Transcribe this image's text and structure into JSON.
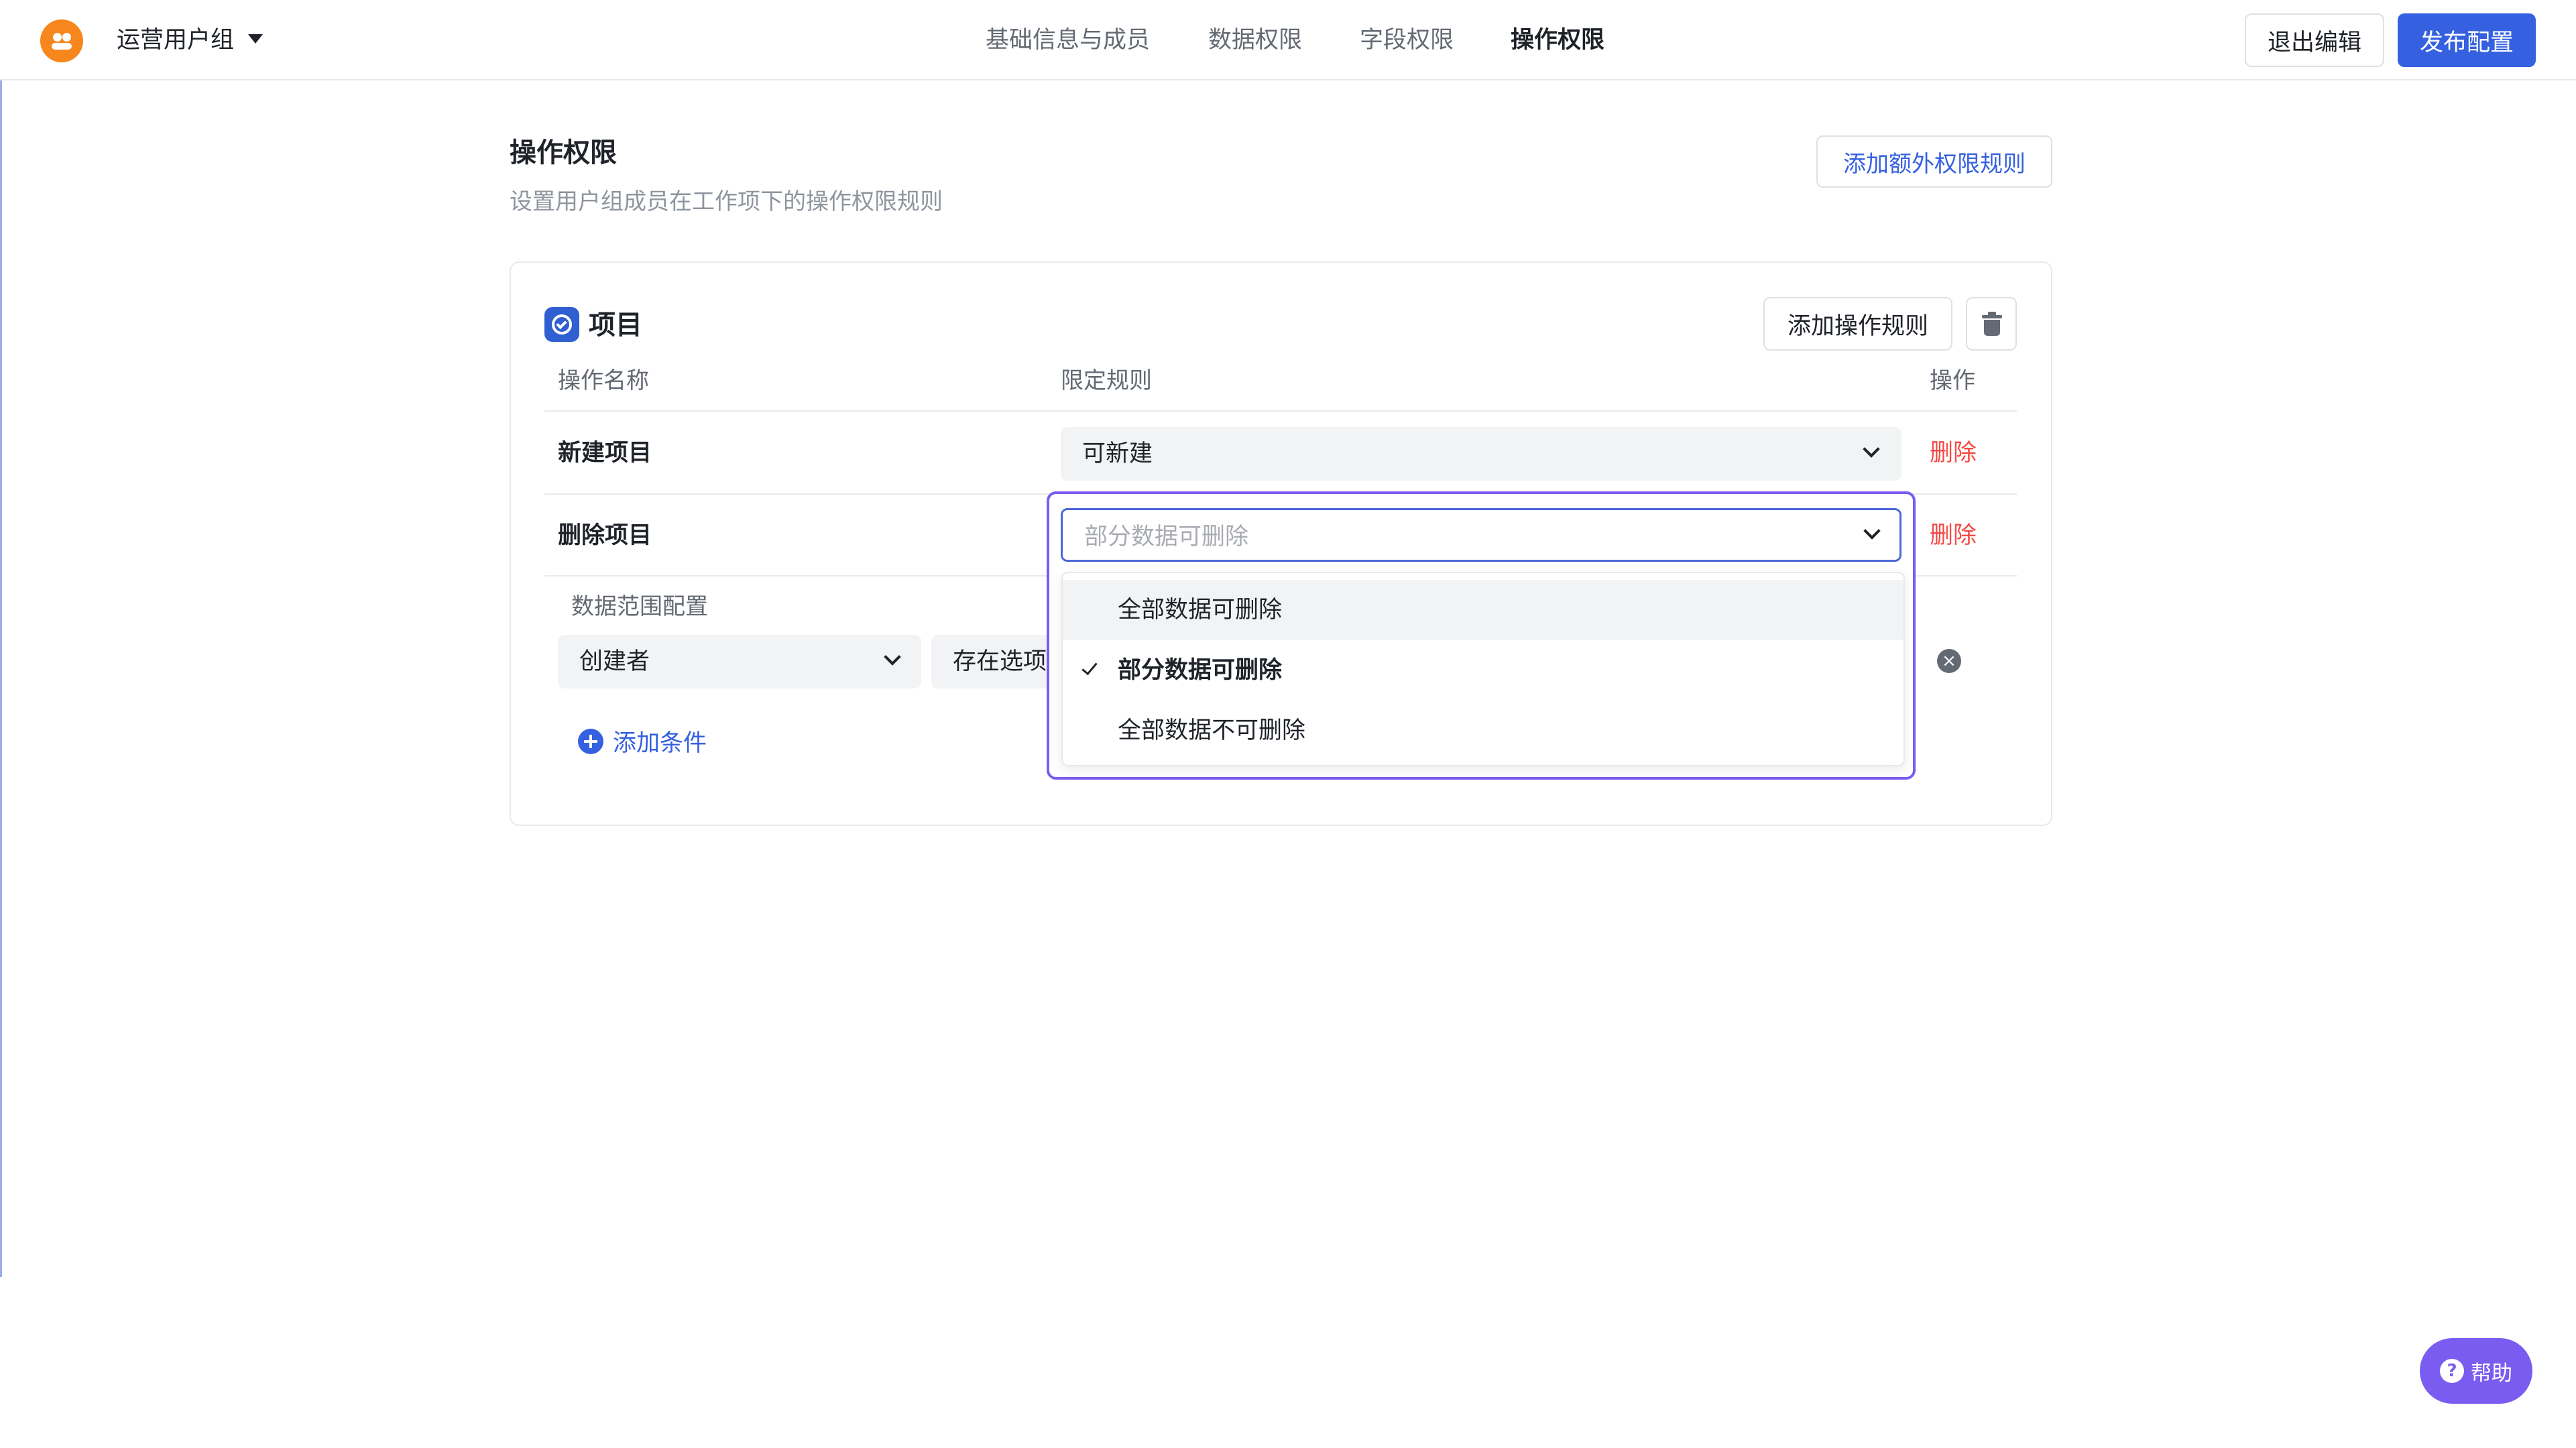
{
  "header": {
    "group_name": "运营用户组",
    "tabs": [
      "基础信息与成员",
      "数据权限",
      "字段权限",
      "操作权限"
    ],
    "active_tab": "操作权限",
    "exit_label": "退出编辑",
    "publish_label": "发布配置"
  },
  "section": {
    "title": "操作权限",
    "description": "设置用户组成员在工作项下的操作权限规则",
    "add_extra_label": "添加额外权限规则"
  },
  "card": {
    "title": "项目",
    "add_rule_label": "添加操作规则",
    "columns": {
      "name": "操作名称",
      "rule": "限定规则",
      "action": "操作"
    },
    "rows": [
      {
        "name": "新建项目",
        "rule": "可新建",
        "action": "删除"
      },
      {
        "name": "删除项目",
        "rule": "部分数据可删除",
        "action": "删除"
      }
    ],
    "scope": {
      "label": "数据范围配置",
      "field": "创建者",
      "operator": "存在选项",
      "add_condition_label": "添加条件"
    }
  },
  "dropdown": {
    "options": [
      "全部数据可删除",
      "部分数据可删除",
      "全部数据不可删除"
    ],
    "selected": "部分数据可删除",
    "hovered": "全部数据可删除"
  },
  "help": {
    "label": "帮助"
  },
  "colors": {
    "primary": "#3560e0",
    "danger": "#f54a45",
    "accent_purple": "#7b5cf0",
    "logo_orange": "#f7861c"
  }
}
